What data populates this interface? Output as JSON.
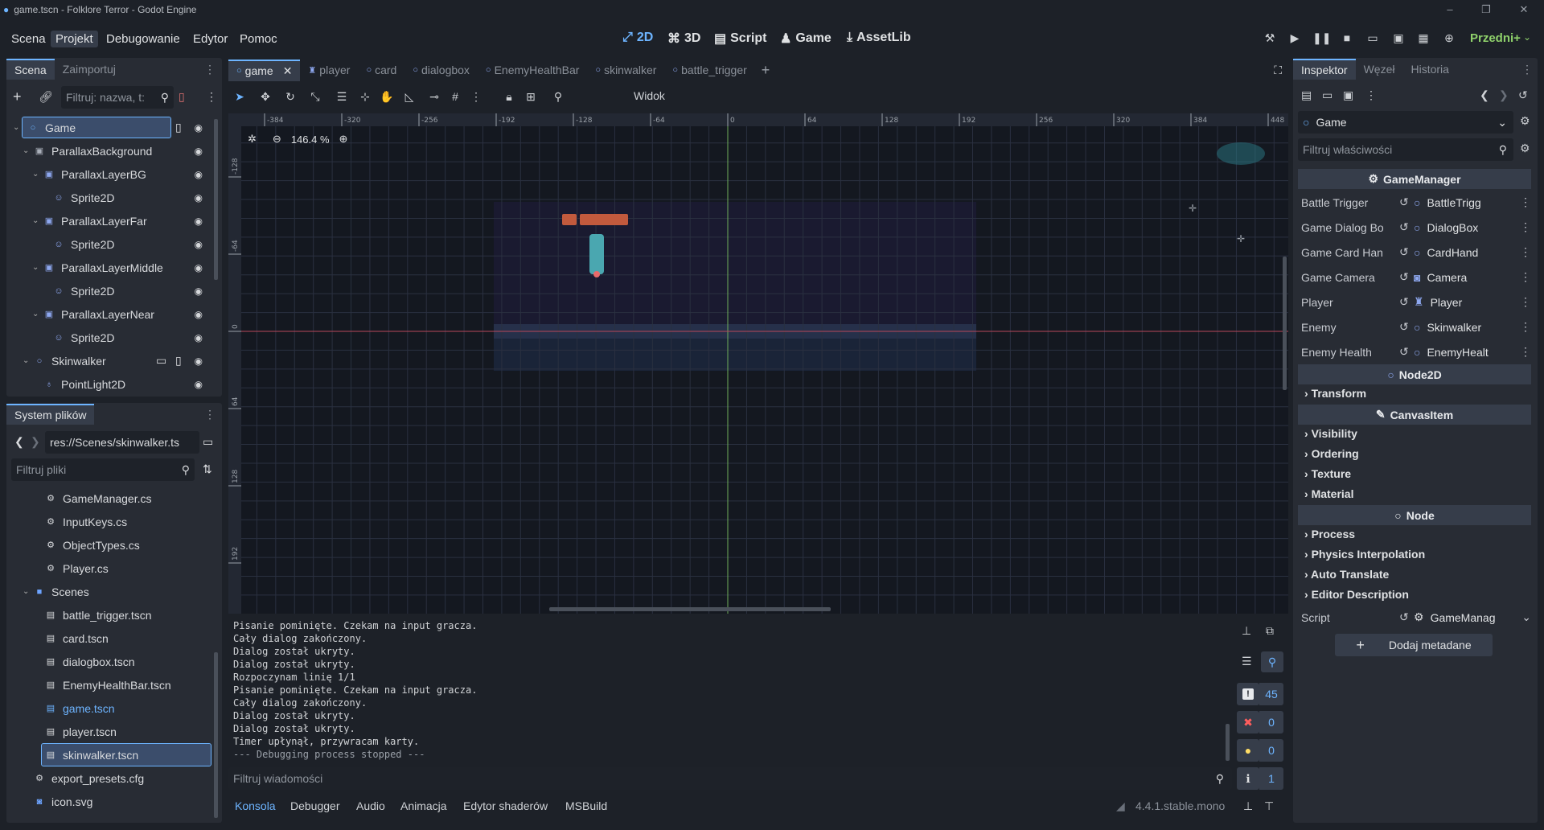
{
  "window": {
    "title": "game.tscn - Folklore Terror - Godot Engine"
  },
  "menu": [
    "Scena",
    "Projekt",
    "Debugowanie",
    "Edytor",
    "Pomoc"
  ],
  "modes": [
    "2D",
    "3D",
    "Script",
    "Game",
    "AssetLib"
  ],
  "renderer": "Przedni+",
  "scene_dock": {
    "tabs": [
      "Scena",
      "Zaimportuj"
    ],
    "filter_placeholder": "Filtruj: nazwa, t:",
    "tree": [
      {
        "label": "Game"
      },
      {
        "label": "ParallaxBackground"
      },
      {
        "label": "ParallaxLayerBG"
      },
      {
        "label": "Sprite2D"
      },
      {
        "label": "ParallaxLayerFar"
      },
      {
        "label": "Sprite2D"
      },
      {
        "label": "ParallaxLayerMiddle"
      },
      {
        "label": "Sprite2D"
      },
      {
        "label": "ParallaxLayerNear"
      },
      {
        "label": "Sprite2D"
      },
      {
        "label": "Skinwalker"
      },
      {
        "label": "PointLight2D"
      }
    ]
  },
  "fs_dock": {
    "title": "System plików",
    "path": "res://Scenes/skinwalker.ts",
    "filter_placeholder": "Filtruj pliki",
    "items": [
      {
        "label": "GameManager.cs"
      },
      {
        "label": "InputKeys.cs"
      },
      {
        "label": "ObjectTypes.cs"
      },
      {
        "label": "Player.cs"
      },
      {
        "label": "Scenes"
      },
      {
        "label": "battle_trigger.tscn"
      },
      {
        "label": "card.tscn"
      },
      {
        "label": "dialogbox.tscn"
      },
      {
        "label": "EnemyHealthBar.tscn"
      },
      {
        "label": "game.tscn"
      },
      {
        "label": "player.tscn"
      },
      {
        "label": "skinwalker.tscn"
      },
      {
        "label": "export_presets.cfg"
      },
      {
        "label": "icon.svg"
      }
    ]
  },
  "editor_tabs": [
    "game",
    "player",
    "card",
    "dialogbox",
    "EnemyHealthBar",
    "skinwalker",
    "battle_trigger"
  ],
  "toolbar": {
    "view_label": "Widok"
  },
  "viewport": {
    "zoom": "146.4 %",
    "ruler_ticks": [
      "-384",
      "-320",
      "-256",
      "-192",
      "-128",
      "-64",
      "0",
      "64",
      "128",
      "192",
      "256",
      "320",
      "384",
      "448"
    ],
    "ruler_v_ticks": [
      "-128",
      "-64",
      "0",
      "64",
      "128",
      "192"
    ]
  },
  "console": {
    "lines": [
      "Pisanie pominięte. Czekam na input gracza.",
      "Cały dialog zakończony.",
      "Dialog został ukryty.",
      "Dialog został ukryty.",
      "Rozpoczynam linię 1/1",
      "Pisanie pominięte. Czekam na input gracza.",
      "Cały dialog zakończony.",
      "Dialog został ukryty.",
      "Dialog został ukryty.",
      "Timer upłynął, przywracam karty.",
      "--- Debugging process stopped ---"
    ],
    "filter_placeholder": "Filtruj wiadomości",
    "counts": {
      "messages": "45",
      "errors": "0",
      "warnings": "0",
      "info": "1"
    }
  },
  "bottom_tabs": [
    "Konsola",
    "Debugger",
    "Audio",
    "Animacja",
    "Edytor shaderów",
    "MSBuild"
  ],
  "version": "4.4.1.stable.mono",
  "inspector": {
    "tabs": [
      "Inspektor",
      "Węzeł",
      "Historia"
    ],
    "node": "Game",
    "filter_placeholder": "Filtruj właściwości",
    "script_section": "GameManager",
    "props": [
      {
        "key": "Battle Trigger",
        "value": "BattleTrigg"
      },
      {
        "key": "Game Dialog Bo",
        "value": "DialogBox"
      },
      {
        "key": "Game Card Han",
        "value": "CardHand"
      },
      {
        "key": "Game Camera",
        "value": "Camera"
      },
      {
        "key": "Player",
        "value": "Player"
      },
      {
        "key": "Enemy",
        "value": "Skinwalker"
      },
      {
        "key": "Enemy Health",
        "value": "EnemyHealt"
      }
    ],
    "sections": [
      "Node2D",
      "CanvasItem",
      "Node"
    ],
    "groups_node2d": [
      "Transform"
    ],
    "groups_canvas": [
      "Visibility",
      "Ordering",
      "Texture",
      "Material"
    ],
    "groups_node": [
      "Process",
      "Physics Interpolation",
      "Auto Translate",
      "Editor Description"
    ],
    "script_key": "Script",
    "script_value": "GameManag",
    "add_metadata": "Dodaj metadane"
  },
  "colors": {
    "accent": "#6db4ff",
    "bg": "#1d2128",
    "panel": "#282c34"
  }
}
